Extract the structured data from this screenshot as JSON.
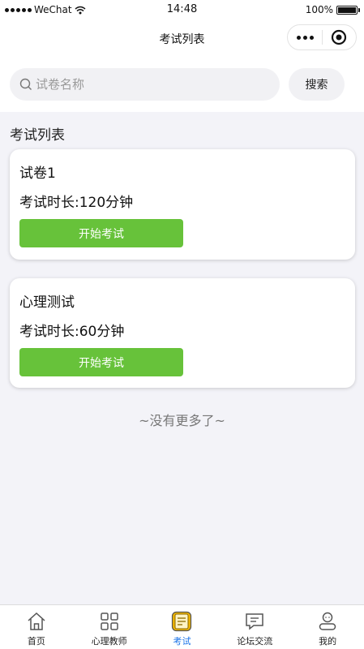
{
  "status_bar": {
    "carrier": "WeChat",
    "time": "14:48",
    "battery": "100%"
  },
  "nav": {
    "title": "考试列表"
  },
  "search": {
    "placeholder": "试卷名称",
    "button_label": "搜索"
  },
  "section_title": "考试列表",
  "exams": [
    {
      "name": "试卷1",
      "duration": "考试时长:120分钟",
      "button_label": "开始考试"
    },
    {
      "name": "心理测试",
      "duration": "考试时长:60分钟",
      "button_label": "开始考试"
    }
  ],
  "no_more_text": "~没有更多了~",
  "tab_bar": {
    "active_color": "#1a73e8",
    "items": [
      {
        "label": "首页",
        "icon": "home-icon"
      },
      {
        "label": "心理教师",
        "icon": "grid-icon"
      },
      {
        "label": "考试",
        "icon": "exam-icon"
      },
      {
        "label": "论坛交流",
        "icon": "chat-icon"
      },
      {
        "label": "我的",
        "icon": "user-icon"
      }
    ]
  },
  "colors": {
    "start_button": "#67c23a",
    "page_background": "#f3f3f8"
  }
}
